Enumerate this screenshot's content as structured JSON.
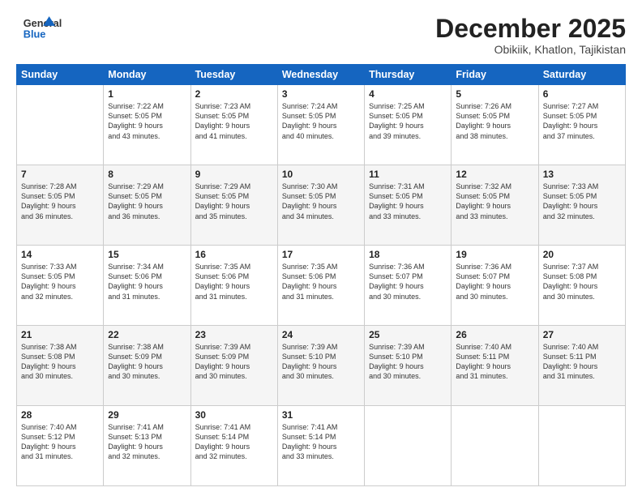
{
  "header": {
    "logo_line1": "General",
    "logo_line2": "Blue",
    "month": "December 2025",
    "location": "Obikiik, Khatlon, Tajikistan"
  },
  "days_of_week": [
    "Sunday",
    "Monday",
    "Tuesday",
    "Wednesday",
    "Thursday",
    "Friday",
    "Saturday"
  ],
  "weeks": [
    [
      {
        "day": "",
        "info": ""
      },
      {
        "day": "1",
        "info": "Sunrise: 7:22 AM\nSunset: 5:05 PM\nDaylight: 9 hours\nand 43 minutes."
      },
      {
        "day": "2",
        "info": "Sunrise: 7:23 AM\nSunset: 5:05 PM\nDaylight: 9 hours\nand 41 minutes."
      },
      {
        "day": "3",
        "info": "Sunrise: 7:24 AM\nSunset: 5:05 PM\nDaylight: 9 hours\nand 40 minutes."
      },
      {
        "day": "4",
        "info": "Sunrise: 7:25 AM\nSunset: 5:05 PM\nDaylight: 9 hours\nand 39 minutes."
      },
      {
        "day": "5",
        "info": "Sunrise: 7:26 AM\nSunset: 5:05 PM\nDaylight: 9 hours\nand 38 minutes."
      },
      {
        "day": "6",
        "info": "Sunrise: 7:27 AM\nSunset: 5:05 PM\nDaylight: 9 hours\nand 37 minutes."
      }
    ],
    [
      {
        "day": "7",
        "info": "Sunrise: 7:28 AM\nSunset: 5:05 PM\nDaylight: 9 hours\nand 36 minutes."
      },
      {
        "day": "8",
        "info": "Sunrise: 7:29 AM\nSunset: 5:05 PM\nDaylight: 9 hours\nand 36 minutes."
      },
      {
        "day": "9",
        "info": "Sunrise: 7:29 AM\nSunset: 5:05 PM\nDaylight: 9 hours\nand 35 minutes."
      },
      {
        "day": "10",
        "info": "Sunrise: 7:30 AM\nSunset: 5:05 PM\nDaylight: 9 hours\nand 34 minutes."
      },
      {
        "day": "11",
        "info": "Sunrise: 7:31 AM\nSunset: 5:05 PM\nDaylight: 9 hours\nand 33 minutes."
      },
      {
        "day": "12",
        "info": "Sunrise: 7:32 AM\nSunset: 5:05 PM\nDaylight: 9 hours\nand 33 minutes."
      },
      {
        "day": "13",
        "info": "Sunrise: 7:33 AM\nSunset: 5:05 PM\nDaylight: 9 hours\nand 32 minutes."
      }
    ],
    [
      {
        "day": "14",
        "info": "Sunrise: 7:33 AM\nSunset: 5:05 PM\nDaylight: 9 hours\nand 32 minutes."
      },
      {
        "day": "15",
        "info": "Sunrise: 7:34 AM\nSunset: 5:06 PM\nDaylight: 9 hours\nand 31 minutes."
      },
      {
        "day": "16",
        "info": "Sunrise: 7:35 AM\nSunset: 5:06 PM\nDaylight: 9 hours\nand 31 minutes."
      },
      {
        "day": "17",
        "info": "Sunrise: 7:35 AM\nSunset: 5:06 PM\nDaylight: 9 hours\nand 31 minutes."
      },
      {
        "day": "18",
        "info": "Sunrise: 7:36 AM\nSunset: 5:07 PM\nDaylight: 9 hours\nand 30 minutes."
      },
      {
        "day": "19",
        "info": "Sunrise: 7:36 AM\nSunset: 5:07 PM\nDaylight: 9 hours\nand 30 minutes."
      },
      {
        "day": "20",
        "info": "Sunrise: 7:37 AM\nSunset: 5:08 PM\nDaylight: 9 hours\nand 30 minutes."
      }
    ],
    [
      {
        "day": "21",
        "info": "Sunrise: 7:38 AM\nSunset: 5:08 PM\nDaylight: 9 hours\nand 30 minutes."
      },
      {
        "day": "22",
        "info": "Sunrise: 7:38 AM\nSunset: 5:09 PM\nDaylight: 9 hours\nand 30 minutes."
      },
      {
        "day": "23",
        "info": "Sunrise: 7:39 AM\nSunset: 5:09 PM\nDaylight: 9 hours\nand 30 minutes."
      },
      {
        "day": "24",
        "info": "Sunrise: 7:39 AM\nSunset: 5:10 PM\nDaylight: 9 hours\nand 30 minutes."
      },
      {
        "day": "25",
        "info": "Sunrise: 7:39 AM\nSunset: 5:10 PM\nDaylight: 9 hours\nand 30 minutes."
      },
      {
        "day": "26",
        "info": "Sunrise: 7:40 AM\nSunset: 5:11 PM\nDaylight: 9 hours\nand 31 minutes."
      },
      {
        "day": "27",
        "info": "Sunrise: 7:40 AM\nSunset: 5:11 PM\nDaylight: 9 hours\nand 31 minutes."
      }
    ],
    [
      {
        "day": "28",
        "info": "Sunrise: 7:40 AM\nSunset: 5:12 PM\nDaylight: 9 hours\nand 31 minutes."
      },
      {
        "day": "29",
        "info": "Sunrise: 7:41 AM\nSunset: 5:13 PM\nDaylight: 9 hours\nand 32 minutes."
      },
      {
        "day": "30",
        "info": "Sunrise: 7:41 AM\nSunset: 5:14 PM\nDaylight: 9 hours\nand 32 minutes."
      },
      {
        "day": "31",
        "info": "Sunrise: 7:41 AM\nSunset: 5:14 PM\nDaylight: 9 hours\nand 33 minutes."
      },
      {
        "day": "",
        "info": ""
      },
      {
        "day": "",
        "info": ""
      },
      {
        "day": "",
        "info": ""
      }
    ]
  ]
}
